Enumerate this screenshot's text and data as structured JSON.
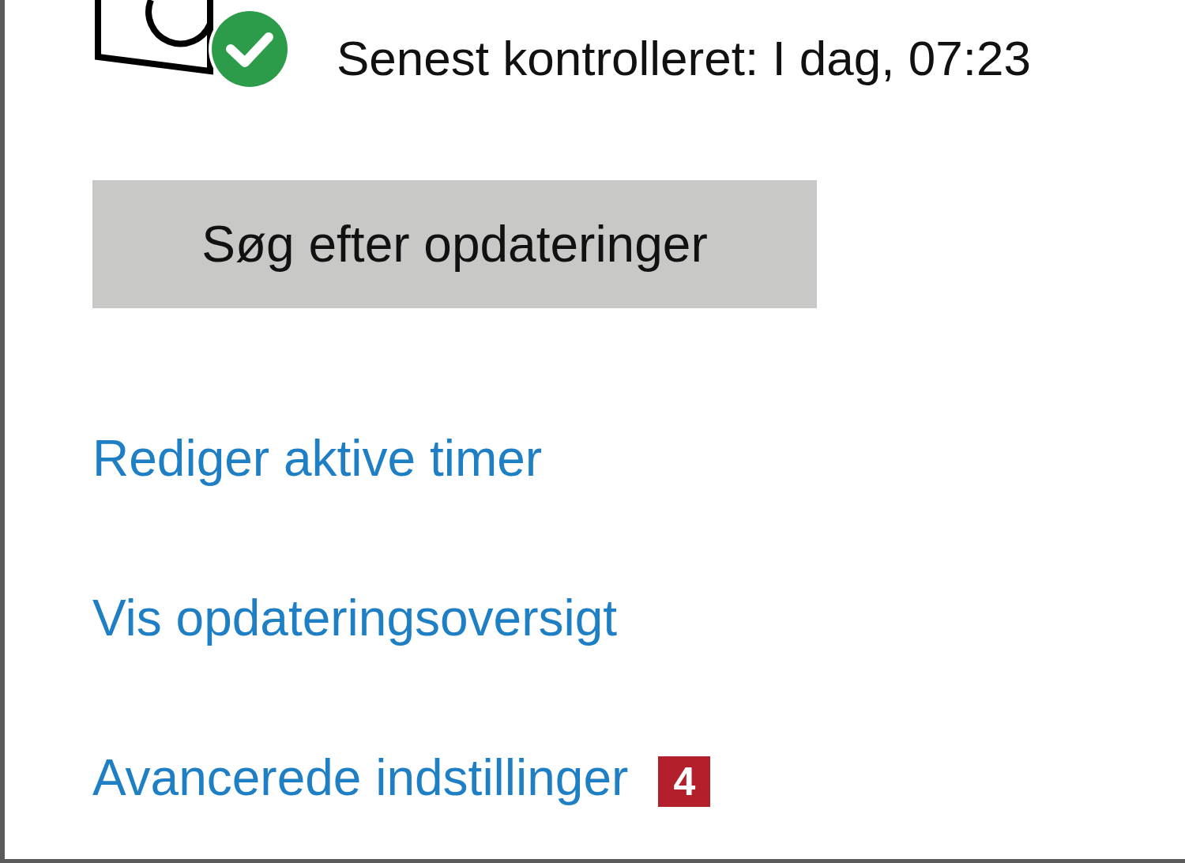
{
  "status": {
    "text": "Senest kontrolleret: I dag, 07:23"
  },
  "check_button": {
    "label": "Søg efter opdateringer"
  },
  "links": [
    {
      "label": "Rediger aktive timer"
    },
    {
      "label": "Vis opdateringsoversigt"
    },
    {
      "label": "Avancerede indstillinger",
      "badge": "4"
    }
  ]
}
